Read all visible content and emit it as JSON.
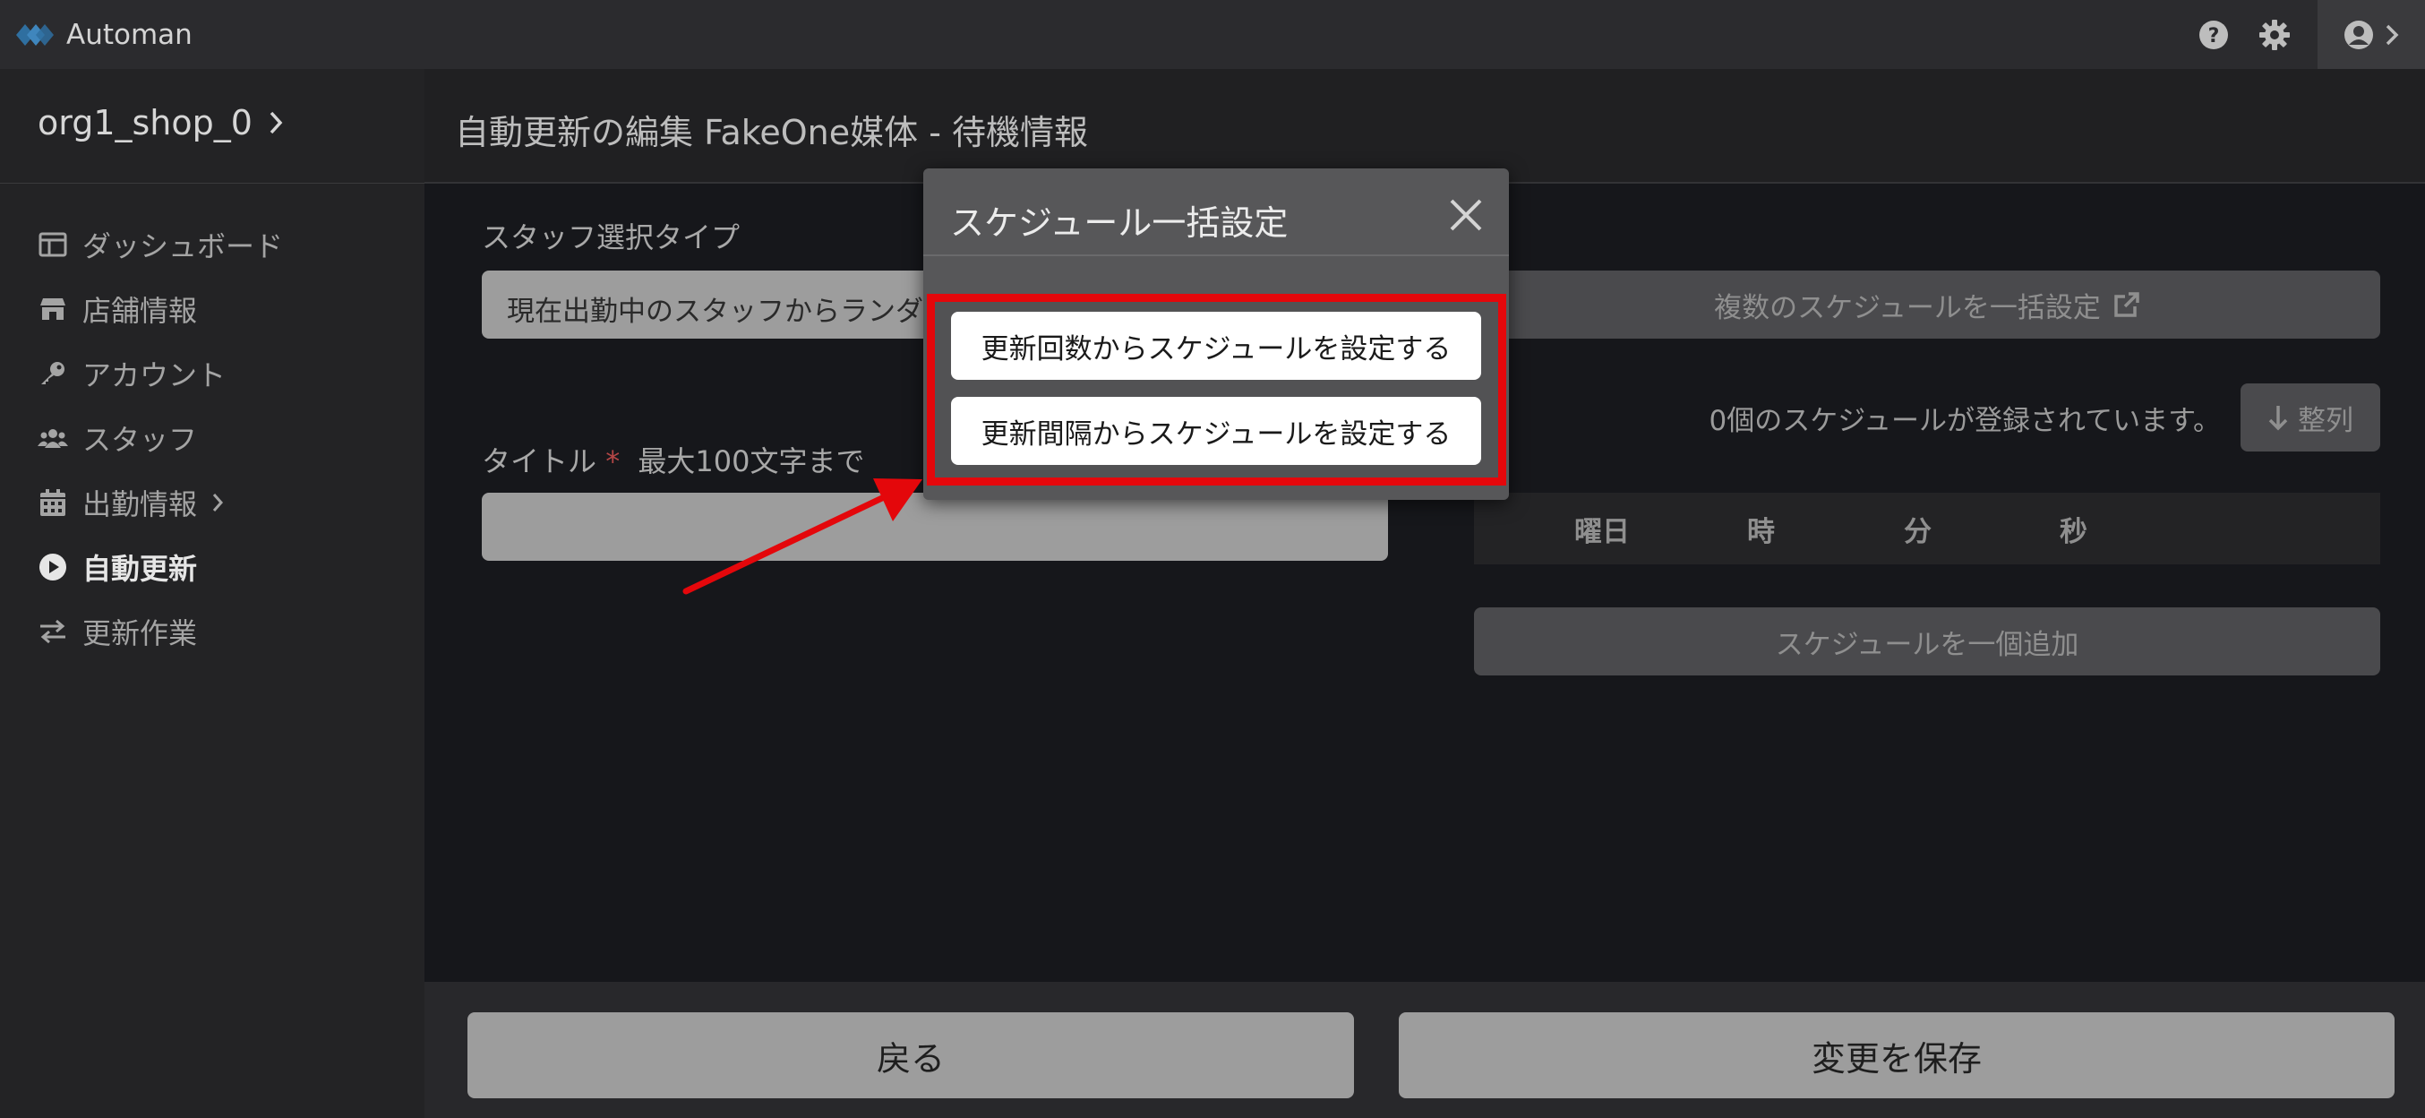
{
  "app": {
    "name": "Automan"
  },
  "colors": {
    "accent_red": "#e4070b",
    "modal_bg": "#575759",
    "logo_blue": "#2f6fa0"
  },
  "topbar": {
    "icons": [
      "help-icon",
      "gear-icon",
      "user-icon",
      "chevron-right-icon"
    ]
  },
  "sidebar": {
    "org_name": "org1_shop_0",
    "items": [
      {
        "label": "ダッシュボード",
        "icon": "dashboard-icon"
      },
      {
        "label": "店舗情報",
        "icon": "store-icon"
      },
      {
        "label": "アカウント",
        "icon": "key-icon"
      },
      {
        "label": "スタッフ",
        "icon": "users-icon"
      },
      {
        "label": "出勤情報",
        "icon": "calendar-icon"
      },
      {
        "label": "自動更新",
        "icon": "play-circle-icon",
        "active": true
      },
      {
        "label": "更新作業",
        "icon": "swap-arrows-icon"
      }
    ]
  },
  "header": {
    "title": "自動更新の編集 FakeOne媒体 - 待機情報"
  },
  "form": {
    "staff_type_label": "スタッフ選択タイプ",
    "staff_type_value": "現在出勤中のスタッフからランダム",
    "title_label": "タイトル",
    "title_required_mark": "*",
    "title_hint": "最大100文字まで",
    "title_value": ""
  },
  "schedule": {
    "bulk_button": "複数のスケジュールを一括設定",
    "count_text": "0個のスケジュールが登録されています。",
    "sort_button": "整列",
    "columns": [
      "曜日",
      "時",
      "分",
      "秒"
    ],
    "add_button": "スケジュールを一個追加"
  },
  "footer": {
    "back_label": "戻る",
    "save_label": "変更を保存"
  },
  "modal": {
    "title": "スケジュール一括設定",
    "option_count": "更新回数からスケジュールを設定する",
    "option_interval": "更新間隔からスケジュールを設定する"
  }
}
